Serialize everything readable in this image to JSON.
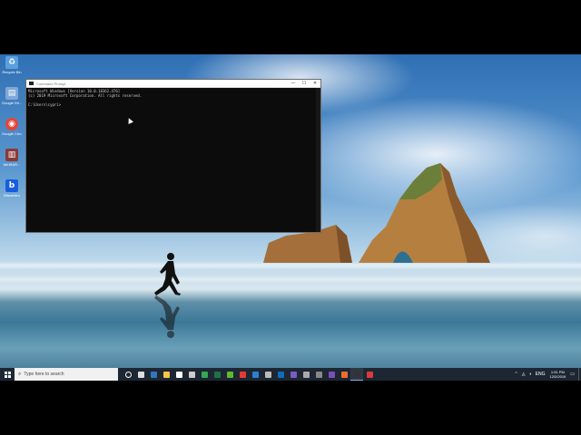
{
  "desktop": {
    "icons": [
      {
        "label": "Recycle Bin",
        "icon": "recycle-bin-icon",
        "color": "#5aa0e0",
        "glyph": "♻"
      },
      {
        "label": "Google Dri...",
        "icon": "drive-icon",
        "color": "#7fa8d8",
        "glyph": "▤"
      },
      {
        "label": "Google Chrome",
        "icon": "chrome-icon",
        "color": "#e3453a",
        "glyph": "◉"
      },
      {
        "label": "WinRAR...",
        "icon": "archive-icon",
        "color": "#8b3a3a",
        "glyph": "▥"
      },
      {
        "label": "Bitwarden",
        "icon": "bitwarden-icon",
        "color": "#175ddc",
        "glyph": "b"
      }
    ]
  },
  "cmd_window": {
    "title": "Command Prompt",
    "minimize": "—",
    "maximize": "☐",
    "close": "✕",
    "lines": [
      "Microsoft Windows [Version 10.0.18362.476]",
      "(c) 2019 Microsoft Corporation. All rights reserved.",
      "",
      "C:\\Users\\cypri>"
    ]
  },
  "taskbar": {
    "search_placeholder": "Type here to search",
    "apps": [
      {
        "name": "cortana-icon",
        "color": "#ffffff"
      },
      {
        "name": "task-view-icon",
        "color": "#dddddd"
      },
      {
        "name": "edge-icon",
        "color": "#3277bc"
      },
      {
        "name": "file-explorer-icon",
        "color": "#f3c744"
      },
      {
        "name": "mail-icon",
        "color": "#ffffff"
      },
      {
        "name": "store-icon",
        "color": "#cccccc"
      },
      {
        "name": "chrome-icon",
        "color": "#34a853"
      },
      {
        "name": "excel-icon",
        "color": "#1f7244"
      },
      {
        "name": "camtasia-icon",
        "color": "#5fb832"
      },
      {
        "name": "app-red-icon",
        "color": "#e53935"
      },
      {
        "name": "app-blue-icon",
        "color": "#2d7fd3"
      },
      {
        "name": "app-circle-icon",
        "color": "#bbbbbb"
      },
      {
        "name": "outlook-icon",
        "color": "#0f6cbd"
      },
      {
        "name": "app-purple-icon",
        "color": "#7b5cc4"
      },
      {
        "name": "settings-icon",
        "color": "#aaaaaa"
      },
      {
        "name": "app-gray-icon",
        "color": "#888888"
      },
      {
        "name": "obs-icon",
        "color": "#7a4fb6"
      },
      {
        "name": "app-orange-icon",
        "color": "#ef6c2e"
      },
      {
        "name": "cmd-icon",
        "color": "#333333"
      },
      {
        "name": "app-red2-icon",
        "color": "#d93a3a"
      }
    ],
    "tray": {
      "chevron": "⌃",
      "lang": "ENG",
      "time": "1:51 PM",
      "date": "12/2/2019",
      "notification": "▭"
    }
  }
}
